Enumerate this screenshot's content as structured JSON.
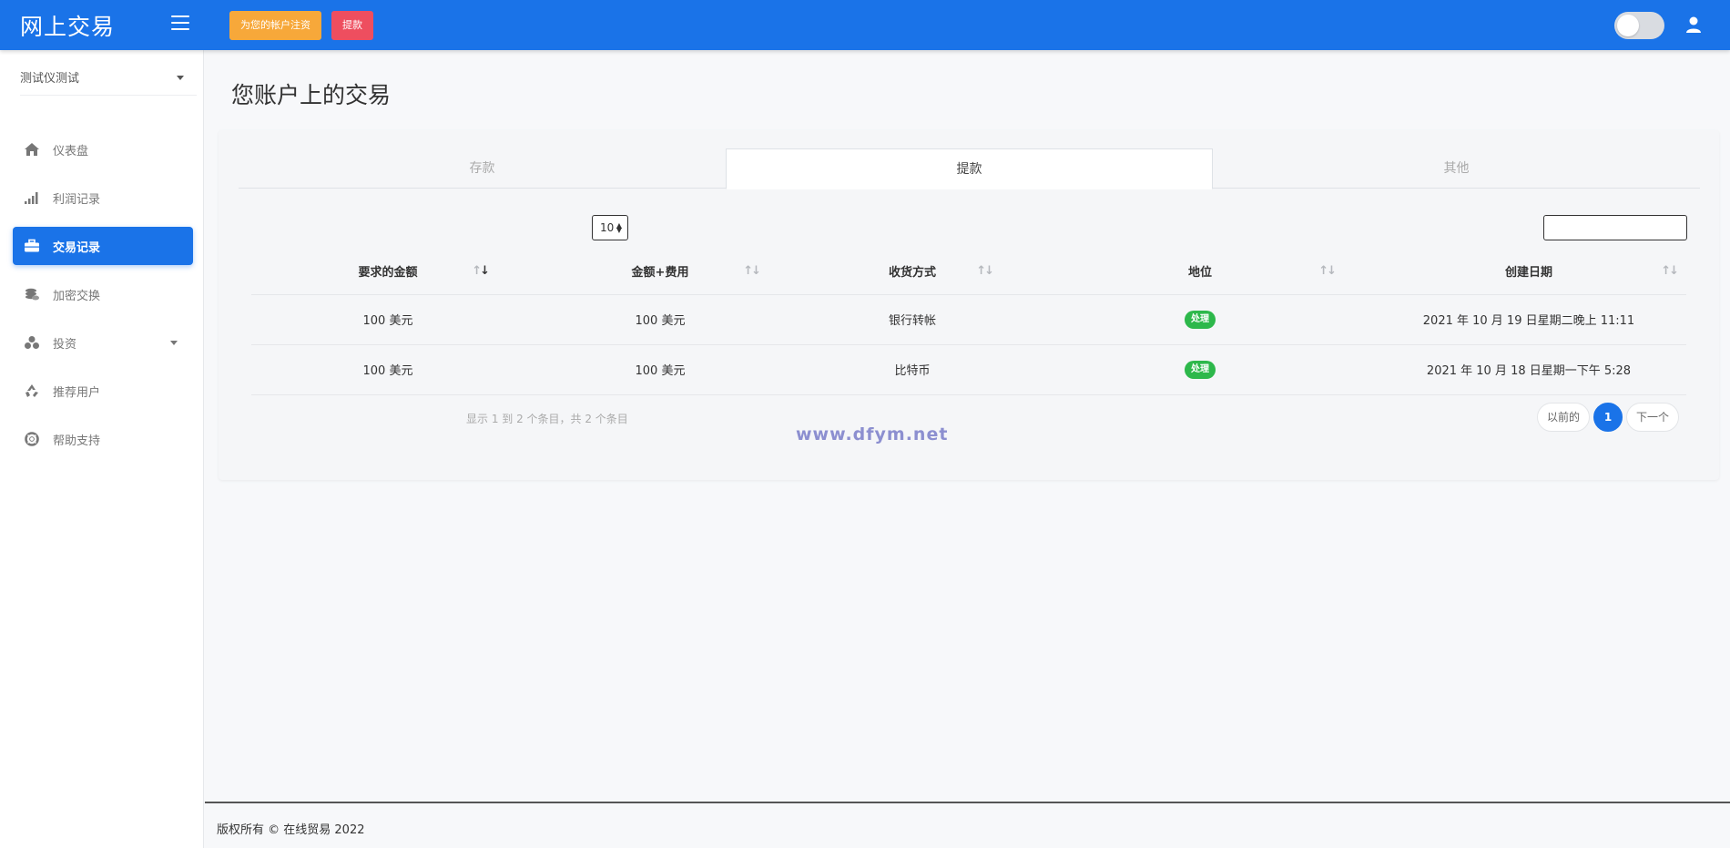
{
  "header": {
    "brand": "网上交易",
    "fund_button": "为您的帐户注资",
    "withdraw_button": "提款",
    "accent": "#1a73e8"
  },
  "sidebar": {
    "account_name": "测试仪测试",
    "items": [
      {
        "label": "仪表盘",
        "icon": "home-icon"
      },
      {
        "label": "利润记录",
        "icon": "signal-bars-icon"
      },
      {
        "label": "交易记录",
        "icon": "briefcase-icon",
        "active": true
      },
      {
        "label": "加密交换",
        "icon": "coins-icon"
      },
      {
        "label": "投资",
        "icon": "cubes-icon"
      },
      {
        "label": "推荐用户",
        "icon": "recycle-icon"
      },
      {
        "label": "帮助支持",
        "icon": "lifering-icon"
      }
    ]
  },
  "main": {
    "title": "您账户上的交易",
    "tabs": [
      "存款",
      "提款",
      "其他"
    ],
    "active_tab": "提款",
    "page_length": "10",
    "table": {
      "headers": [
        "要求的金额",
        "金额+费用",
        "收货方式",
        "地位",
        "创建日期"
      ],
      "rows": [
        [
          "100 美元",
          "100 美元",
          "银行转帐",
          "处理",
          "2021 年 10 月 19 日星期二晚上 11:11"
        ],
        [
          "100 美元",
          "100 美元",
          "比特币",
          "处理",
          "2021 年 10 月 18 日星期一下午 5:28"
        ]
      ]
    },
    "info": "显示 1 到 2 个条目，共 2 个条目",
    "pagination": {
      "prev": "以前的",
      "current": "1",
      "next": "下一个"
    },
    "watermark": "www.dfym.net"
  },
  "footer": {
    "text": "版权所有 © 在线贸易 2022"
  }
}
